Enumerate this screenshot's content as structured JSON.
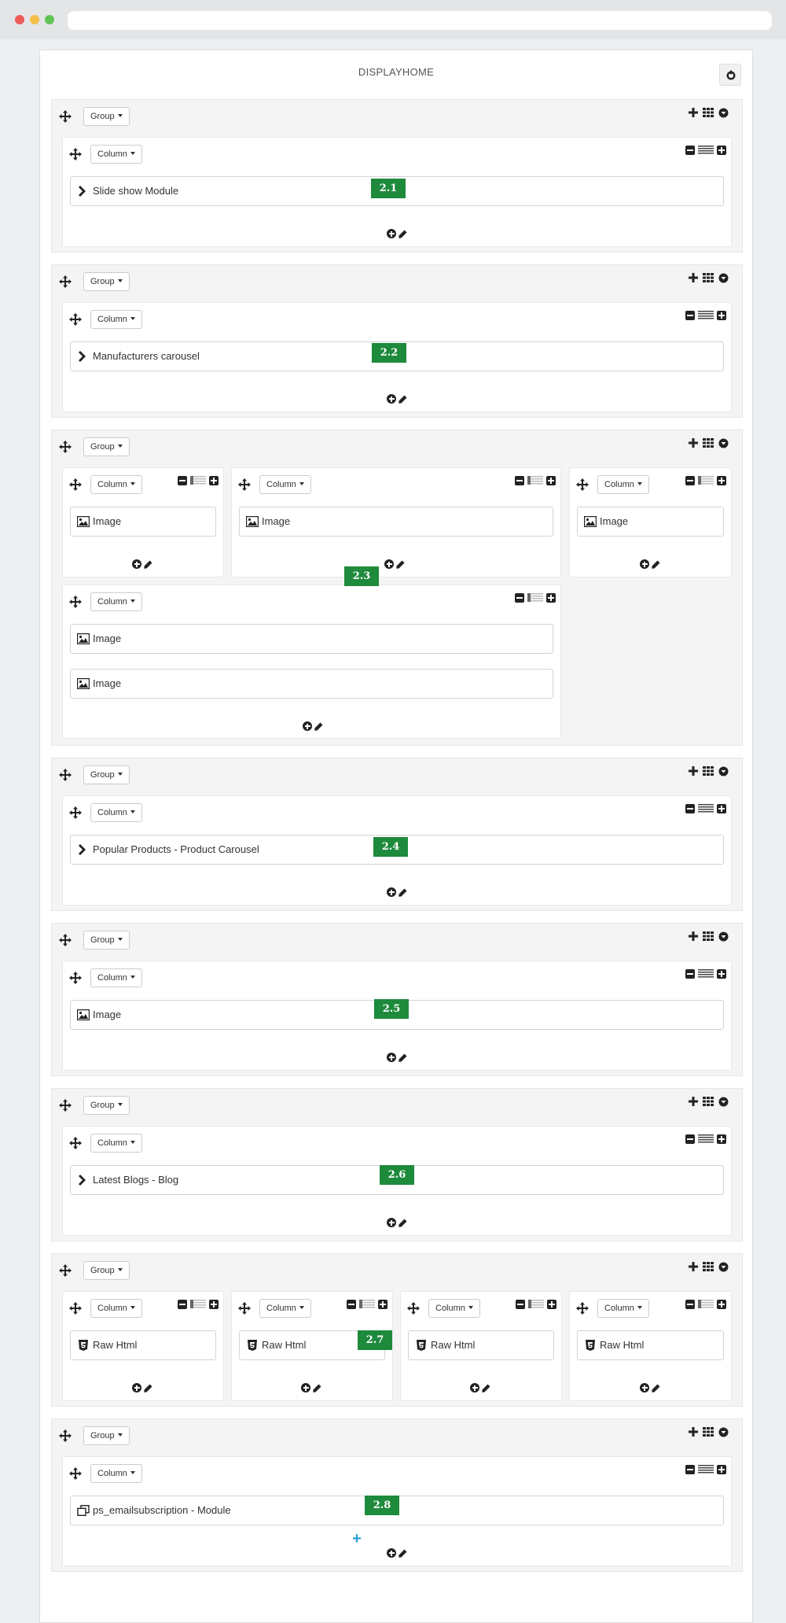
{
  "hook_title": "DISPLAYHOME",
  "group_label": "Group",
  "column_label": "Column",
  "add_group_symbol": "+",
  "colors": {
    "badge": "#1e8a3c",
    "add_group": "#2a9fd6"
  },
  "modules": {
    "slideshow": "Slide show Module",
    "manufacturers": "Manufacturers carousel",
    "image": "Image",
    "popular_products": "Popular Products - Product Carousel",
    "latest_blogs": "Latest Blogs - Blog",
    "raw_html": "Raw Html",
    "email_subscription": "ps_emailsubscription - Module"
  },
  "badges": [
    "2.1",
    "2.2",
    "2.3",
    "2.4",
    "2.5",
    "2.6",
    "2.7",
    "2.8"
  ]
}
